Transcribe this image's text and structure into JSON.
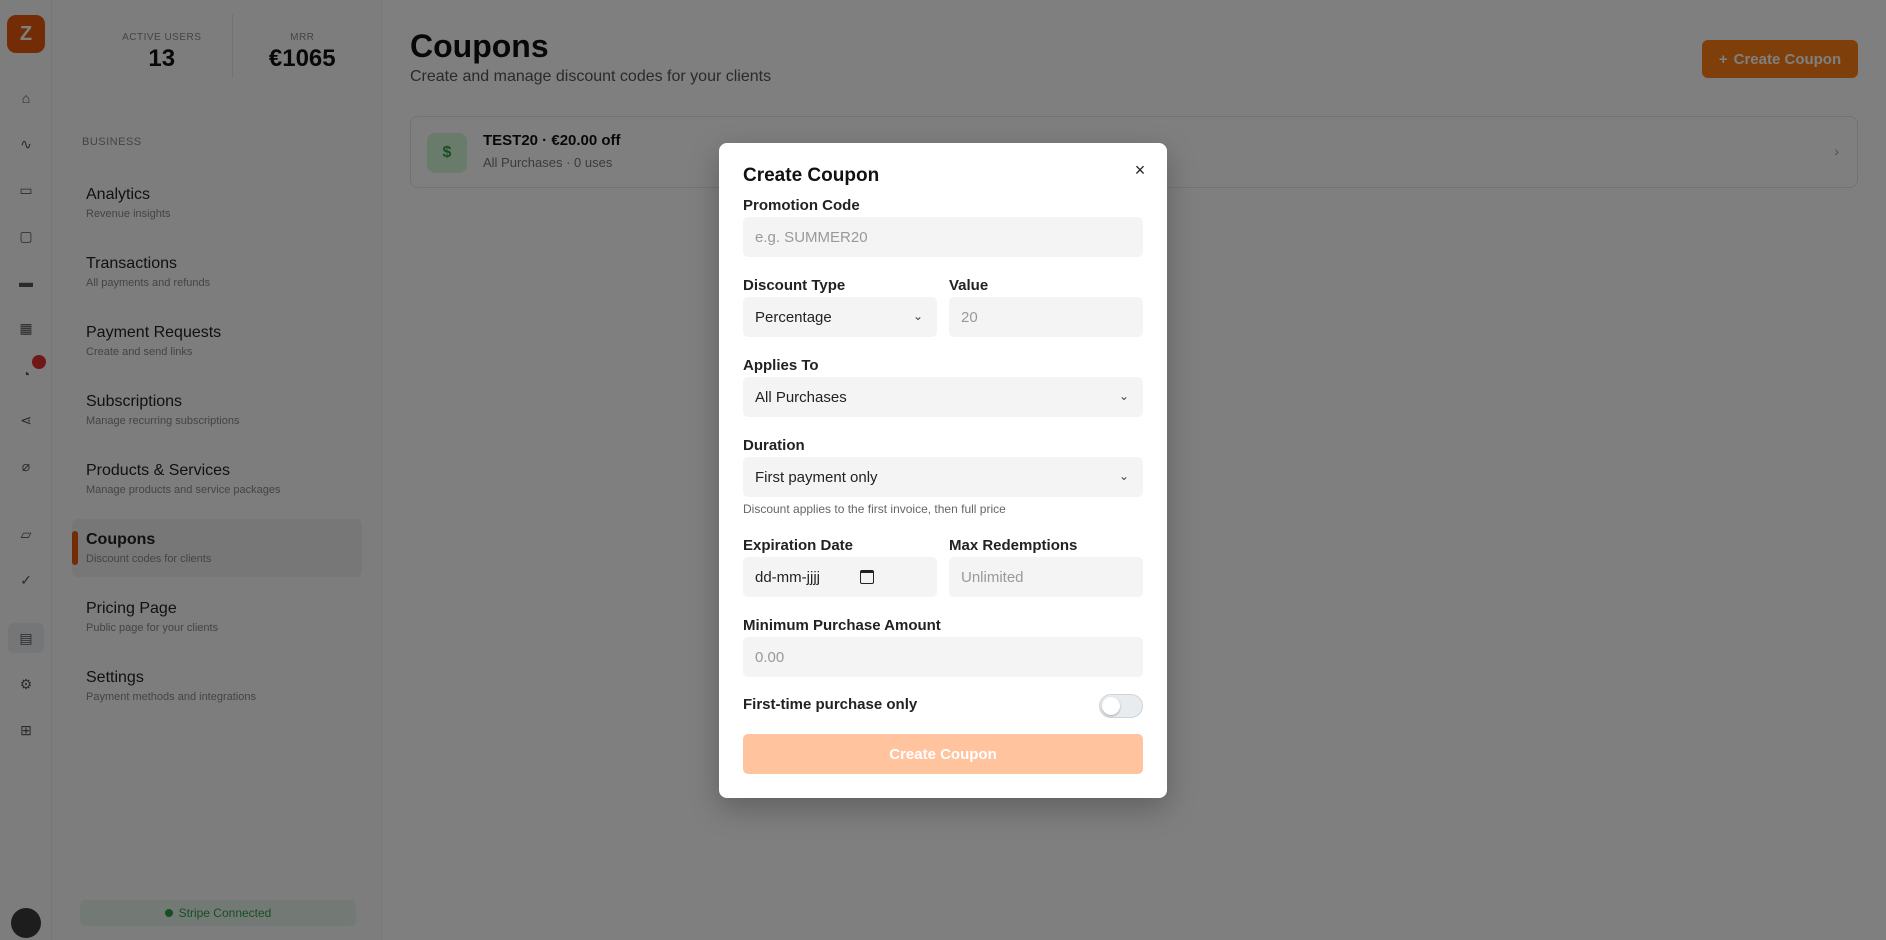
{
  "app": {
    "logo_letter": "Z"
  },
  "rail": {
    "icons": [
      "home-icon",
      "chart-icon",
      "calendar-icon",
      "document-icon",
      "wallet-icon",
      "grid-icon",
      "bell-icon",
      "share-icon",
      "link-icon",
      "chat-icon",
      "check-icon",
      "card-icon",
      "gear-icon",
      "settings-icon"
    ]
  },
  "sidebar": {
    "stats": [
      {
        "label": "Active users",
        "value": "13"
      },
      {
        "label": "MRR",
        "value": "€1065"
      }
    ],
    "section_title": "Business",
    "items": [
      {
        "label": "Analytics",
        "sub": "Revenue insights"
      },
      {
        "label": "Transactions",
        "sub": "All payments and refunds"
      },
      {
        "label": "Payment Requests",
        "sub": "Create and send links"
      },
      {
        "label": "Subscriptions",
        "sub": "Manage recurring subscriptions"
      },
      {
        "label": "Products & Services",
        "sub": "Manage products and service packages"
      },
      {
        "label": "Coupons",
        "sub": "Discount codes for clients"
      },
      {
        "label": "Pricing Page",
        "sub": "Public page for your clients"
      },
      {
        "label": "Settings",
        "sub": "Payment methods and integrations"
      }
    ],
    "connect_label": "Stripe Connected"
  },
  "main": {
    "title": "Coupons",
    "subtitle": "Create and manage discount codes for your clients",
    "create_button": "Create Coupon",
    "create_button_icon": "+",
    "coupon": {
      "icon_letter": "$",
      "code": "TEST20 · €20.00 off",
      "meta": "All Purchases · 0 uses"
    }
  },
  "modal": {
    "title": "Create Coupon",
    "close_glyph": "×",
    "promotion_code": {
      "label": "Promotion Code",
      "placeholder": "e.g. SUMMER20"
    },
    "discount_type": {
      "label": "Discount Type",
      "value": "Percentage"
    },
    "value_field": {
      "label": "Value",
      "placeholder": "20"
    },
    "applies_to": {
      "label": "Applies To",
      "value": "All Purchases"
    },
    "duration": {
      "label": "Duration",
      "value": "First payment only",
      "hint": "Discount applies to the first invoice, then full price"
    },
    "expiration": {
      "label": "Expiration Date",
      "placeholder": "dd-mm-jjjj"
    },
    "max_redemptions": {
      "label": "Max Redemptions",
      "placeholder": "Unlimited"
    },
    "min_purchase": {
      "label": "Minimum Purchase Amount",
      "placeholder": "0.00"
    },
    "first_time": {
      "label": "First-time purchase only",
      "enabled": false
    },
    "submit_label": "Create Coupon"
  }
}
